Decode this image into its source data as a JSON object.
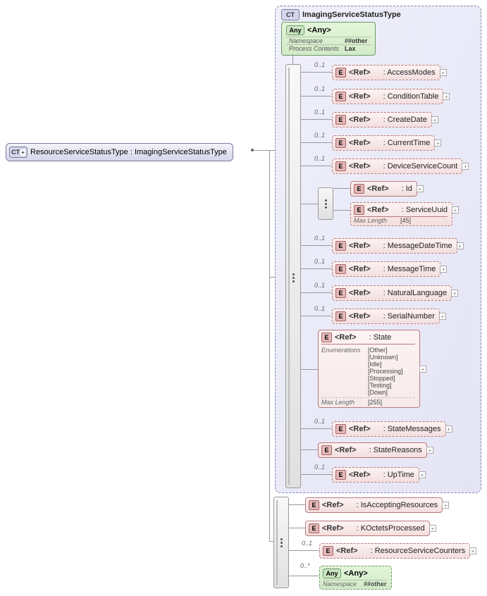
{
  "left_ct": {
    "badge": "CT",
    "label": "ResourceServiceStatusType : ImagingServiceStatusType"
  },
  "main_container": {
    "badge": "CT",
    "title": "ImagingServiceStatusType"
  },
  "any_block": {
    "badge": "Any",
    "label": "<Any>",
    "rows": [
      {
        "label": "Namespace",
        "value": "##other"
      },
      {
        "label": "Process Contents",
        "value": "Lax"
      }
    ]
  },
  "cardinality": "0..1",
  "cardinality_star": "0..*",
  "ref_label": "<Ref>",
  "ref_prefix": ": ",
  "main_refs": [
    {
      "name": "AccessModes",
      "optional": true,
      "toggle": true
    },
    {
      "name": "ConditionTable",
      "optional": true,
      "toggle": true
    },
    {
      "name": "CreateDate",
      "optional": true,
      "toggle": true
    },
    {
      "name": "CurrentTime",
      "optional": true,
      "toggle": true
    },
    {
      "name": "DeviceServiceCount",
      "optional": true,
      "toggle": true
    }
  ],
  "choice_refs": [
    {
      "name": "Id",
      "optional": false,
      "toggle": true
    },
    {
      "name": "ServiceUuid",
      "optional": false,
      "toggle": true,
      "maxlength_label": "Max Length",
      "maxlength_value": "[45]"
    }
  ],
  "mid_refs": [
    {
      "name": "MessageDateTime",
      "optional": true,
      "toggle": true
    },
    {
      "name": "MessageTime",
      "optional": true,
      "toggle": true
    },
    {
      "name": "NaturalLanguage",
      "optional": true,
      "toggle": true
    },
    {
      "name": "SerialNumber",
      "optional": true,
      "toggle": true
    }
  ],
  "state_block": {
    "name": "State",
    "enum_label": "Enumerations",
    "enums": [
      "[Other]",
      "[Unknown]",
      "[Idle]",
      "[Processing]",
      "[Stopped]",
      "[Testing]",
      "[Down]"
    ],
    "maxlength_label": "Max Length",
    "maxlength_value": "[255]"
  },
  "tail_refs": [
    {
      "name": "StateMessages",
      "optional": true,
      "toggle": true
    },
    {
      "name": "StateReasons",
      "optional": false,
      "toggle": true
    },
    {
      "name": "UpTime",
      "optional": true,
      "toggle": true
    }
  ],
  "bottom_refs": [
    {
      "name": "IsAcceptingResources",
      "optional": false,
      "toggle": true
    },
    {
      "name": "KOctetsProcessed",
      "optional": false,
      "toggle": true
    },
    {
      "name": "ResourceServiceCounters",
      "optional": true,
      "toggle": true
    }
  ],
  "bottom_any": {
    "badge": "Any",
    "label": "<Any>",
    "rows": [
      {
        "label": "Namespace",
        "value": "##other"
      }
    ]
  }
}
